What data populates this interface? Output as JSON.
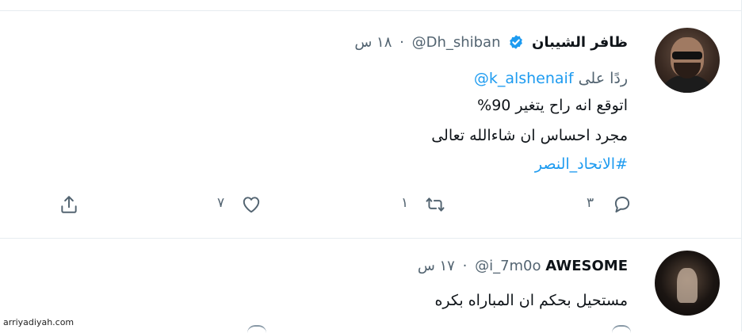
{
  "tweet1": {
    "author_name": "ظافر الشيبان",
    "handle": "@Dh_shiban",
    "separator": "·",
    "time": "١٨ س",
    "replying_label": "ردًا على",
    "replying_to": "@k_alshenaif",
    "lines": [
      "اتوقع انه راح يتغير 90%",
      "مجرد احساس ان شاءالله تعالى"
    ],
    "hashtag": "#الاتحاد_النصر",
    "counts": {
      "replies": "٣",
      "retweets": "١",
      "likes": "٧"
    }
  },
  "tweet2": {
    "author_name": "AWESOME",
    "handle": "@i_7m0o",
    "separator": "·",
    "time": "١٧ س",
    "text": "مستحيل بحكم ان المباراه بكره"
  },
  "watermark": "arriyadiyah.com",
  "colors": {
    "accent": "#1d9bf0",
    "muted": "#536471",
    "border": "#e6ecf0"
  },
  "icons": [
    "verified-badge-icon",
    "reply-icon",
    "retweet-icon",
    "like-icon",
    "share-icon"
  ]
}
